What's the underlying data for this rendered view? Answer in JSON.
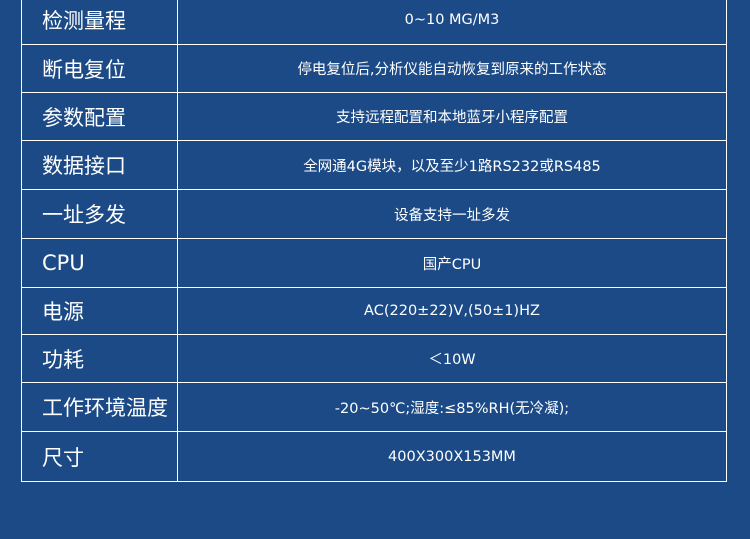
{
  "specs": [
    {
      "label": "检测量程",
      "value": "0~10 MG/M3"
    },
    {
      "label": "断电复位",
      "value": "停电复位后,分析仪能自动恢复到原来的工作状态"
    },
    {
      "label": "参数配置",
      "value": "支持远程配置和本地蓝牙小程序配置"
    },
    {
      "label": "数据接口",
      "value": "全网通4G模块，以及至少1路RS232或RS485"
    },
    {
      "label": "一址多发",
      "value": "设备支持一址多发"
    },
    {
      "label": "CPU",
      "value": "国产CPU"
    },
    {
      "label": "电源",
      "value": "AC(220±22)V,(50±1)HZ"
    },
    {
      "label": "功耗",
      "value": "＜10W"
    },
    {
      "label": "工作环境温度",
      "value": "-20~50℃;湿度:≤85%RH(无冷凝);"
    },
    {
      "label": "尺寸",
      "value": "400X300X153MM"
    }
  ]
}
